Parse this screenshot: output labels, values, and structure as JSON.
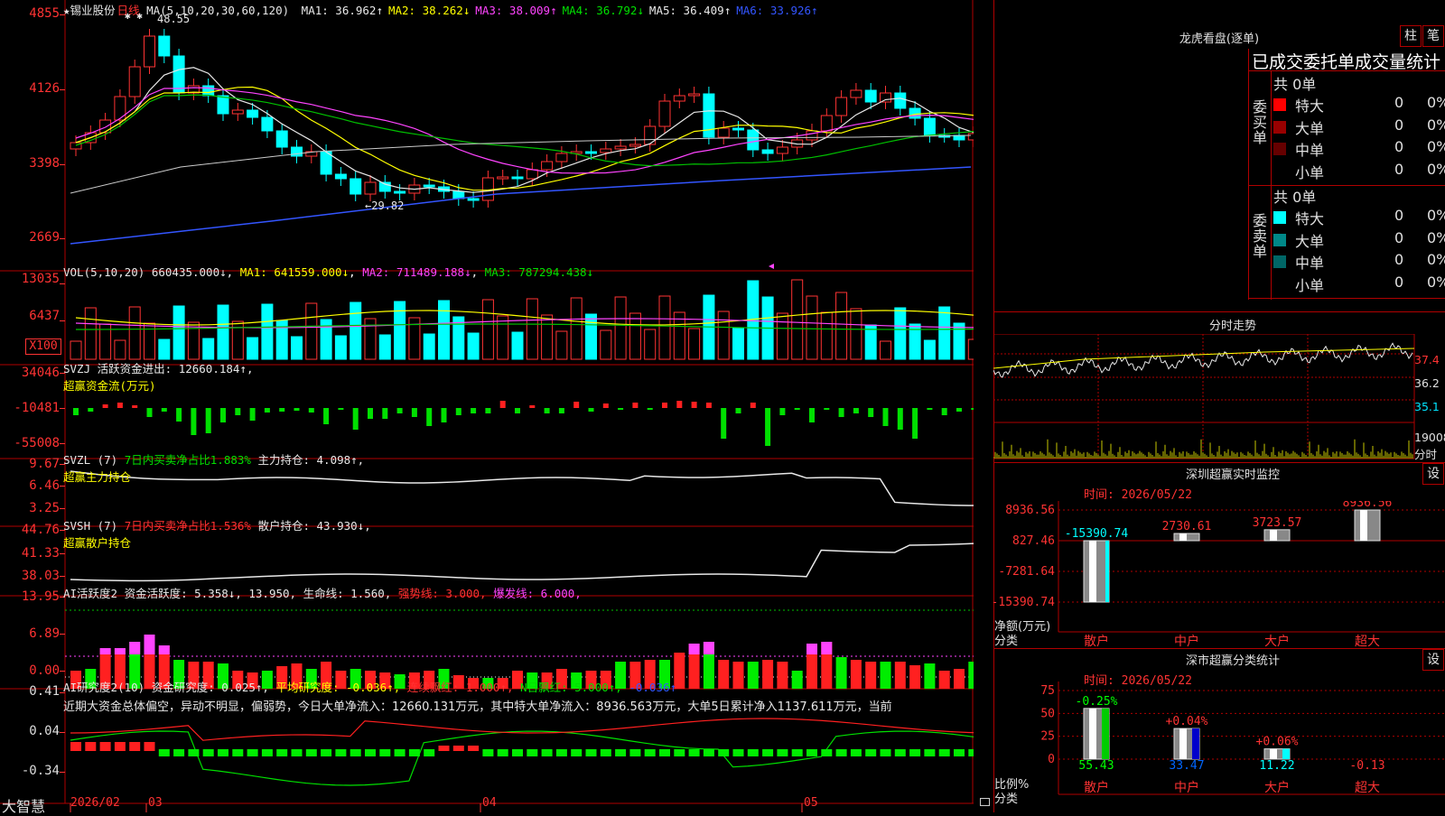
{
  "stock": {
    "star": "★",
    "name": "锡业股份",
    "period": "日线",
    "ma_params": "MA(5,10,20,30,60,120)"
  },
  "main_chart": {
    "y_ticks": [
      "4855",
      "4126",
      "3398",
      "2669"
    ],
    "ma_values": [
      {
        "label": "MA1:",
        "value": "36.962",
        "arrow": "↑",
        "color": "#e8e8e8"
      },
      {
        "label": "MA2:",
        "value": "38.262",
        "arrow": "↓",
        "color": "#ffff00"
      },
      {
        "label": "MA3:",
        "value": "38.009",
        "arrow": "↑",
        "color": "#ff44ff"
      },
      {
        "label": "MA4:",
        "value": "36.792",
        "arrow": "↓",
        "color": "#00e000"
      },
      {
        "label": "MA5:",
        "value": "36.409",
        "arrow": "↑",
        "color": "#e8e8e8"
      },
      {
        "label": "MA6:",
        "value": "33.926",
        "arrow": "↑",
        "color": "#3355ff"
      }
    ],
    "high_label": "48.55",
    "low_label": "←29.82",
    "high_markers": "✱ ✱"
  },
  "volume": {
    "title": "VOL(5,10,20)",
    "value": "660435.000↓",
    "ma1": "MA1: 641559.000↓",
    "ma2": "MA2: 711489.188↓",
    "ma3": "MA3: 787294.438↓",
    "y_ticks": [
      "13035",
      "6437"
    ],
    "unit": "X100"
  },
  "svzj": {
    "title": "SVZJ",
    "line1": "活跃资金进出: 12660.184↑,",
    "line2": "超赢资金流(万元)",
    "y_ticks": [
      "34046",
      "-10481",
      "-55008"
    ]
  },
  "svzl": {
    "title": "SVZL (7)",
    "ratio": "7日内买卖净占比1.883%",
    "holding": "主力持仓: 4.098↑,",
    "line2": "超赢主力持仓",
    "y_ticks": [
      "9.67",
      "6.46",
      "3.25"
    ]
  },
  "svsh": {
    "title": "SVSH (7)",
    "ratio": "7日内买卖净占比1.536%",
    "holding": "散户持仓: 43.930↓,",
    "line2": "超赢散户持仓",
    "y_ticks": [
      "44.76",
      "41.33",
      "38.03"
    ]
  },
  "ai_active": {
    "title": "AI活跃度2",
    "v1": "资金活跃度: 5.358↓,",
    "v2": "13.950,",
    "v3": "生命线: 1.560,",
    "v4": "强势线: 3.000,",
    "v5": "爆发线: 6.000,",
    "y_ticks": [
      "13.95",
      "6.89",
      "0.00"
    ]
  },
  "ai_research": {
    "title": "AI研究度2(10)",
    "v1": "资金研究度: 0.025↑,",
    "v2": "平均研究度: -0.036↑,",
    "v3": "连续飘红: 1.000↑,",
    "v4": "N日飘红: 5.000↑,",
    "v5": "-0.036↑",
    "comment": "近期大资金总体偏空，异动不明显，偏弱势，今日大单净流入：12660.131万元，其中特大单净流入：8936.563万元，大单5日累计净入1137.611万元，当前",
    "y_ticks": [
      "0.41",
      "0.04",
      "-0.34"
    ]
  },
  "x_axis": {
    "brand": "大智慧",
    "labels": [
      "2026/02",
      "03",
      "04",
      "05"
    ]
  },
  "longhu": {
    "title": "龙虎看盘(逐单)",
    "btn1": "柱",
    "btn2": "笔",
    "header": "已成交委托单成交量统计",
    "buy_side": "委买单",
    "sell_side": "委卖单",
    "buy_total": "共 0单",
    "sell_total": "共 0单",
    "buy_rows": [
      {
        "name": "特大",
        "count": "0",
        "pct": "0%",
        "color": "#ff0000"
      },
      {
        "name": "大单",
        "count": "0",
        "pct": "0%",
        "color": "#990000"
      },
      {
        "name": "中单",
        "count": "0",
        "pct": "0%",
        "color": "#660000"
      },
      {
        "name": "小单",
        "count": "0",
        "pct": "0%",
        "color": ""
      }
    ],
    "sell_rows": [
      {
        "name": "特大",
        "count": "0",
        "pct": "0%",
        "color": "#00ffff"
      },
      {
        "name": "大单",
        "count": "0",
        "pct": "0%",
        "color": "#008888"
      },
      {
        "name": "中单",
        "count": "0",
        "pct": "0%",
        "color": "#006666"
      },
      {
        "name": "小单",
        "count": "0",
        "pct": "0%",
        "color": ""
      }
    ]
  },
  "intraday": {
    "title": "分时走势",
    "prices": [
      "37.4",
      "36.2",
      "35.1"
    ],
    "vol": "19008",
    "vol_unit": "分时"
  },
  "sz_monitor": {
    "title": "深圳超赢实时监控",
    "btn": "设",
    "time": "时间: 2026/05/22",
    "y_ticks": [
      "8936.56",
      "827.46",
      "-7281.64",
      "-15390.74"
    ],
    "ylabel1": "净额(万元)",
    "ylabel2": "分类",
    "categories": [
      "散户",
      "中户",
      "大户",
      "超大"
    ],
    "values": [
      "-15390.74",
      "2730.61",
      "3723.57",
      "8936.56"
    ]
  },
  "sz_class": {
    "title": "深市超赢分类统计",
    "btn": "设",
    "time": "时间: 2026/05/22",
    "y_ticks": [
      "75",
      "50",
      "25",
      "0"
    ],
    "ylabel1": "比例%",
    "ylabel2": "分类",
    "categories": [
      "散户",
      "中户",
      "大户",
      "超大"
    ],
    "changes": [
      "-0.25%",
      "+0.04%",
      "+0.06%",
      ""
    ],
    "values": [
      "55.43",
      "33.47",
      "11.22",
      "-0.13"
    ]
  },
  "chart_data": [
    {
      "type": "bar",
      "title": "深圳超赢实时监控",
      "ylabel": "净额(万元)",
      "xlabel": "分类",
      "categories": [
        "散户",
        "中户",
        "大户",
        "超大"
      ],
      "values": [
        -15390.74,
        2730.61,
        3723.57,
        8936.56
      ],
      "ylim": [
        -15390.74,
        8936.56
      ]
    },
    {
      "type": "bar",
      "title": "深市超赢分类统计",
      "ylabel": "比例%",
      "xlabel": "分类",
      "categories": [
        "散户",
        "中户",
        "大户",
        "超大"
      ],
      "values": [
        55.43,
        33.47,
        11.22,
        -0.13
      ],
      "ylim": [
        0,
        75
      ]
    }
  ]
}
